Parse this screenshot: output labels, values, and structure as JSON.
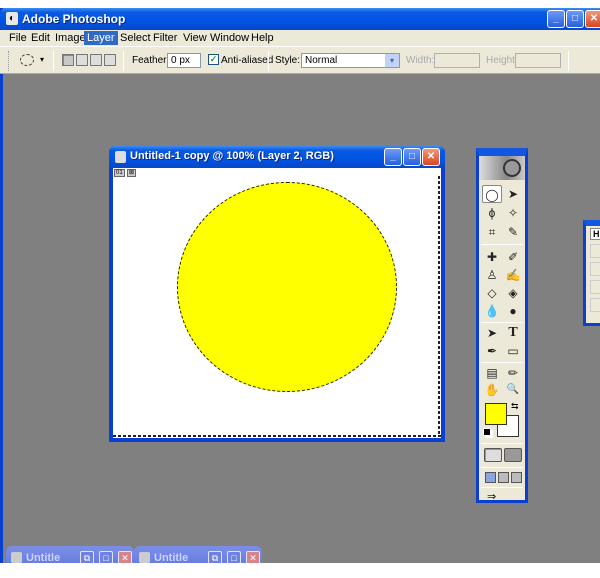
{
  "app": {
    "title": "Adobe Photoshop",
    "window_controls": {
      "minimize": "_",
      "maximize": "□",
      "close": "✕"
    }
  },
  "menubar": {
    "items": [
      {
        "label": "File"
      },
      {
        "label": "Edit"
      },
      {
        "label": "Image"
      },
      {
        "label": "Layer",
        "active": true
      },
      {
        "label": "Select"
      },
      {
        "label": "Filter"
      },
      {
        "label": "View"
      },
      {
        "label": "Window"
      },
      {
        "label": "Help"
      }
    ]
  },
  "options_bar": {
    "tool_preset_icon": "elliptical-marquee-icon",
    "preset_arrow": "▾",
    "selection_modes": [
      "new-selection",
      "add-to-selection",
      "subtract-from-selection",
      "intersect-selection"
    ],
    "feather_label": "Feather:",
    "feather_value": "0 px",
    "anti_aliased_label": "Anti-aliased",
    "anti_aliased_checked": true,
    "check_glyph": "✓",
    "style_label": "Style:",
    "style_value": "Normal",
    "style_arrow": "▾",
    "width_label": "Width:",
    "width_value": "",
    "height_label": "Height:",
    "height_value": ""
  },
  "document": {
    "title": "Untitled-1 copy @ 100% (Layer 2, RGB)",
    "status_chips": [
      "01",
      "⊠"
    ],
    "fill_color": "#ffff00"
  },
  "toolbox": {
    "tools": [
      {
        "name": "elliptical-marquee",
        "glyph": "◯",
        "active": true
      },
      {
        "name": "move",
        "glyph": "➤"
      },
      {
        "name": "lasso",
        "glyph": "ϕ"
      },
      {
        "name": "magic-wand",
        "glyph": "✧"
      },
      {
        "name": "crop",
        "glyph": "⌗"
      },
      {
        "name": "slice",
        "glyph": "✎"
      },
      {
        "name": "healing-brush",
        "glyph": "✚"
      },
      {
        "name": "brush",
        "glyph": "✐"
      },
      {
        "name": "clone-stamp",
        "glyph": "♙"
      },
      {
        "name": "history-brush",
        "glyph": "✍"
      },
      {
        "name": "eraser",
        "glyph": "◇"
      },
      {
        "name": "paint-bucket",
        "glyph": "◈"
      },
      {
        "name": "blur",
        "glyph": "💧"
      },
      {
        "name": "dodge",
        "glyph": "●"
      },
      {
        "name": "path-selection",
        "glyph": "➤"
      },
      {
        "name": "type",
        "glyph": "T"
      },
      {
        "name": "pen",
        "glyph": "✒"
      },
      {
        "name": "rectangle",
        "glyph": "▭"
      },
      {
        "name": "notes",
        "glyph": "▤"
      },
      {
        "name": "eyedropper",
        "glyph": "✏"
      },
      {
        "name": "hand",
        "glyph": "✋"
      },
      {
        "name": "zoom",
        "glyph": "🔍"
      }
    ],
    "foreground_color": "#ffff00",
    "background_color": "#ffffff",
    "swap_glyph": "⇆",
    "jump_glyph": "⇒"
  },
  "palette": {
    "tab_label": "H"
  },
  "minimized_windows": [
    {
      "title": "Untitle"
    },
    {
      "title": "Untitle"
    }
  ],
  "minimized_controls": {
    "restore": "⧉",
    "maximize": "□",
    "close": "✕"
  }
}
